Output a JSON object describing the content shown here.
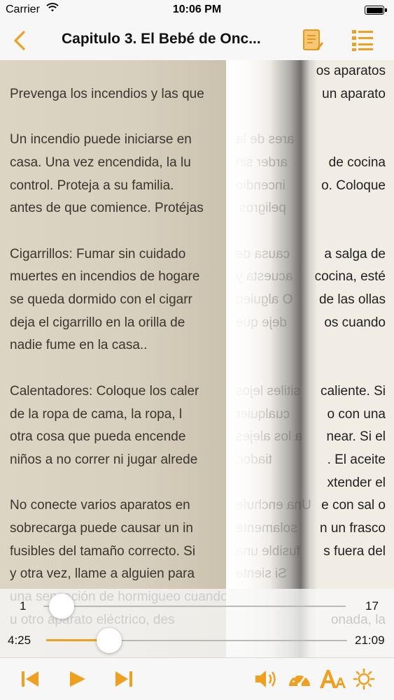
{
  "status_bar": {
    "carrier": "Carrier",
    "time": "10:06 PM"
  },
  "nav": {
    "title": "Capitulo 3. El Bebé de Onc...",
    "accent_color": "#f0a020"
  },
  "reader": {
    "left_lines": [
      "",
      "Prevenga los incendios y las que",
      "",
      "Un incendio puede iniciarse en",
      "casa. Una vez encendida, la lu",
      "control. Proteja a su familia.",
      "antes de que comience. Protéjas",
      "",
      "Cigarrillos: Fumar sin cuidado",
      "muertes en incendios de hogare",
      "se queda dormido con el cigarr",
      "deja el cigarrillo en la orilla de",
      "nadie fume en la casa..",
      "",
      "Calentadores: Coloque los caler",
      "de la ropa de cama, la ropa, l",
      "otra cosa que pueda encende",
      "niños a no correr ni jugar alrede",
      "",
      "No conecte varios aparatos en",
      "sobrecarga puede causar un in",
      "fusibles del tamaño correcto. Si",
      "y otra vez, llame a alguien para",
      "una sensación de hormigueo cuando",
      "u otro aparato eléctrico, des"
    ],
    "right_lines": [
      "os aparatos",
      "un aparato",
      "",
      "",
      "de cocina",
      "o. Coloque",
      "",
      "",
      "a salga de",
      "cocina, esté",
      "de las ollas",
      "os cuando",
      "",
      "",
      "caliente. Si",
      "o con una",
      "near. Si el",
      ". El aceite",
      "xtender el",
      "e con sal o",
      "n un frasco",
      "s fuera del",
      "",
      "",
      "onada, la"
    ],
    "mirror_lines": [
      "",
      "",
      "",
      "ares de la",
      "arder sin",
      "incendio",
      "peligros.",
      "",
      "causa de",
      "acuesta y",
      "O alguien",
      "deje que",
      "",
      "",
      "sitiles lejos",
      "cualquier",
      "a los alejes",
      "tiador.",
      "",
      "Una enchufe",
      "solamente",
      "fusible una",
      "Si siente",
      "",
      ""
    ]
  },
  "player": {
    "page_slider": {
      "min": "1",
      "max": "17",
      "value": 0.06
    },
    "time_slider": {
      "current": "4:25",
      "total": "21:09",
      "value": 0.21
    }
  },
  "toolbar": {
    "icons": [
      "skip-back-icon",
      "play-icon",
      "skip-forward-icon",
      "volume-icon",
      "speedometer-icon",
      "font-size-icon",
      "brightness-icon"
    ]
  }
}
